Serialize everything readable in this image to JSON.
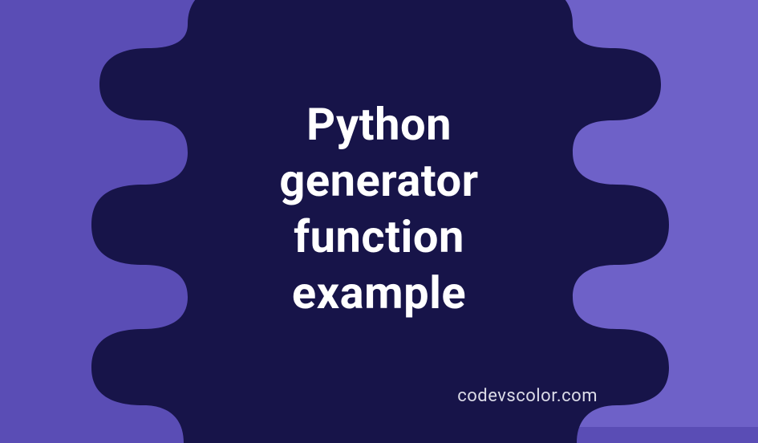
{
  "title_lines": {
    "l1": "Python",
    "l2": "generator",
    "l3": "function",
    "l4": "example"
  },
  "attribution": "codevscolor.com",
  "colors": {
    "bg_left": "#5a4db5",
    "bg_right": "#6e61c8",
    "blob": "#171449",
    "text": "#ffffff"
  }
}
